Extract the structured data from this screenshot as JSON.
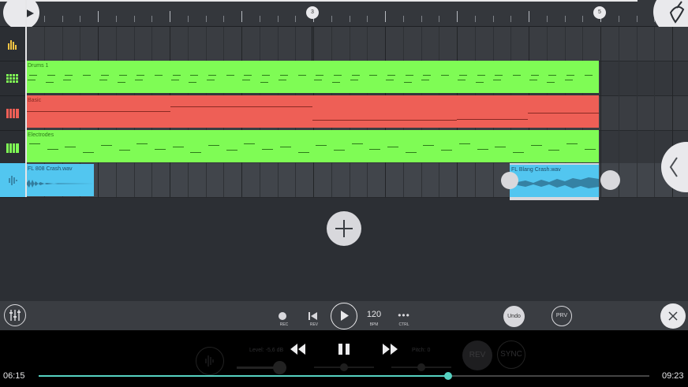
{
  "ruler": {
    "markers": [
      "3",
      "5"
    ]
  },
  "tracks": [
    {
      "name": "Drums 1",
      "icon": "drum-pads-icon",
      "color": "#7ffc55"
    },
    {
      "name": "Basic",
      "icon": "piano-keys-icon",
      "color": "#ee5f56"
    },
    {
      "name": "Electrodes",
      "icon": "piano-keys-icon",
      "color": "#7ffc55"
    },
    {
      "name": "FL 808 Crash.wav",
      "icon": "waveform-icon",
      "color": "#52c6f0"
    }
  ],
  "audio_clip2": "FL Blang Crash.wav",
  "transport": {
    "rec_label": "REC",
    "rev_label": "REV",
    "bpm_value": "120",
    "bpm_label": "BPM",
    "ctrl_label": "CTRL",
    "undo_label": "Undo",
    "prv_label": "PRV"
  },
  "player": {
    "elapsed": "06:15",
    "total": "09:23",
    "progress": 0.67,
    "level_label": "Level: -5,6 dB",
    "pitch_label": "Pitch: 0",
    "rev_label": "REV",
    "sync_label": "SYNC"
  },
  "colors": {
    "accent": "#56d2c2",
    "green_clip": "#7ffc55",
    "red_clip": "#ee5f56",
    "audio_clip": "#52c6f0"
  }
}
